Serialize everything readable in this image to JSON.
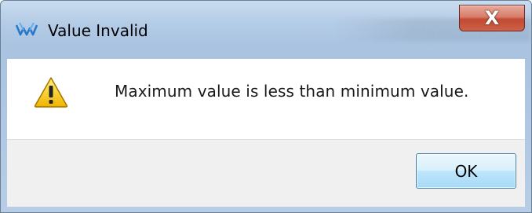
{
  "dialog": {
    "title": "Value Invalid",
    "close_glyph": "X",
    "message": "Maximum value is less than minimum value.",
    "ok_label": "OK",
    "app_icon": "app-logo-icon",
    "message_icon": "warning-icon"
  },
  "colors": {
    "titlebar": "#b3cbe6",
    "close_button": "#c24a32",
    "ok_button_border": "#3c7fb1",
    "footer": "#f0f0f0"
  }
}
